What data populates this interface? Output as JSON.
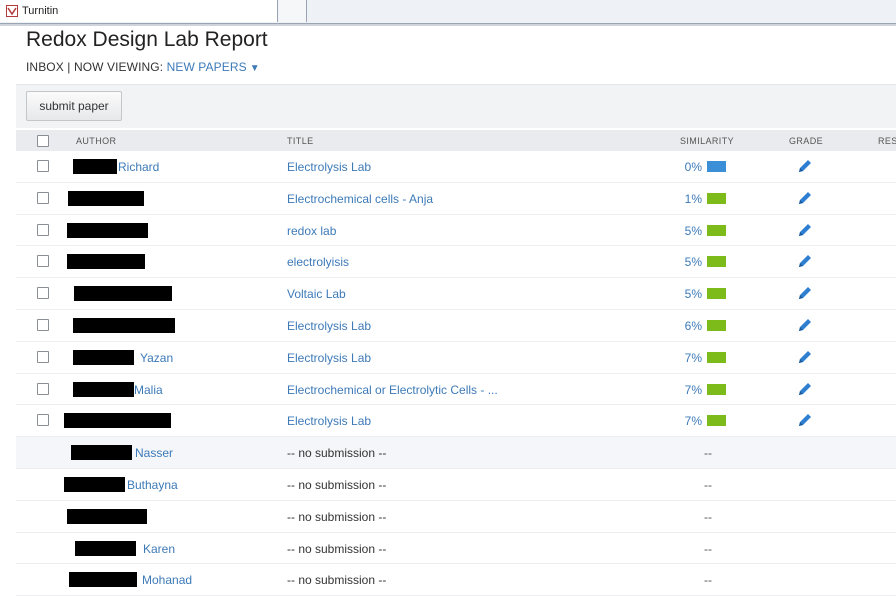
{
  "browser": {
    "tab_title": "Turnitin"
  },
  "page": {
    "title": "Redox Design Lab Report",
    "inbox_label": "INBOX",
    "separator": "|",
    "viewing_label": "NOW VIEWING:",
    "viewing_value": "NEW PAPERS",
    "submit_label": "submit paper"
  },
  "table": {
    "headers": {
      "author": "AUTHOR",
      "title": "TITLE",
      "similarity": "SIMILARITY",
      "grade": "GRADE",
      "response": "RES"
    },
    "rows": [
      {
        "author": "Richard",
        "title": "Electrolysis Lab",
        "similarity": "0%",
        "level": 0.0,
        "color": "#3b8fd6"
      },
      {
        "author": "",
        "title": "Electrochemical cells - Anja",
        "similarity": "1%",
        "level": 0.01,
        "color": "#7dbb1a"
      },
      {
        "author": "",
        "title": "redox lab",
        "similarity": "5%",
        "level": 0.05,
        "color": "#7dbb1a"
      },
      {
        "author": "",
        "title": "electrolyisis",
        "similarity": "5%",
        "level": 0.05,
        "color": "#7dbb1a"
      },
      {
        "author": "",
        "title": "Voltaic Lab",
        "similarity": "5%",
        "level": 0.05,
        "color": "#7dbb1a"
      },
      {
        "author": "",
        "title": "Electrolysis Lab",
        "similarity": "6%",
        "level": 0.06,
        "color": "#7dbb1a"
      },
      {
        "author": "Yazan",
        "title": "Electrolysis Lab",
        "similarity": "7%",
        "level": 0.07,
        "color": "#7dbb1a"
      },
      {
        "author": "Malia",
        "title": "Electrochemical or Electrolytic Cells - ...",
        "similarity": "7%",
        "level": 0.07,
        "color": "#7dbb1a"
      },
      {
        "author": "",
        "title": "Electrolysis Lab",
        "similarity": "7%",
        "level": 0.07,
        "color": "#7dbb1a"
      }
    ],
    "nosub_rows": [
      {
        "author": "Nasser",
        "title": "-- no submission --",
        "similarity": "--"
      },
      {
        "author": "Buthayna",
        "title": "-- no submission --",
        "similarity": "--"
      },
      {
        "author": "",
        "title": "-- no submission --",
        "similarity": "--"
      },
      {
        "author": "Karen",
        "title": "-- no submission --",
        "similarity": "--"
      },
      {
        "author": "Mohanad",
        "title": "-- no submission --",
        "similarity": "--"
      }
    ]
  },
  "colors": {
    "link": "#3d7ab8",
    "match_low": "#7dbb1a",
    "match_zero": "#3b8fd6",
    "pencil": "#2f7fd0"
  }
}
